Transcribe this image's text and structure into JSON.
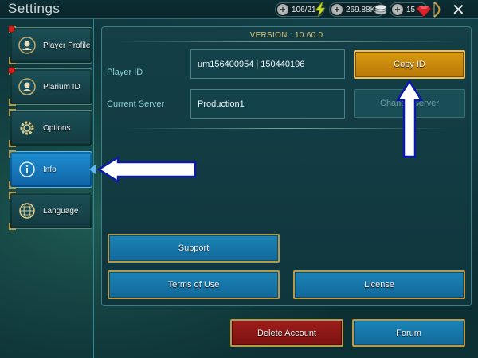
{
  "header": {
    "title": "Settings",
    "resources": [
      {
        "value": "106/21",
        "icon": "energy-bolt-icon"
      },
      {
        "value": "269.88K",
        "icon": "silver-coins-icon"
      },
      {
        "value": "15",
        "icon": "ruby-gem-icon"
      }
    ],
    "close_icon": "✕"
  },
  "sidebar": {
    "items": [
      {
        "label": "Player Profile",
        "icon": "user-circle-icon",
        "notification": true
      },
      {
        "label": "Plarium ID",
        "icon": "user-circle-icon",
        "notification": true
      },
      {
        "label": "Options",
        "icon": "gear-icon",
        "notification": false
      },
      {
        "label": "Info",
        "icon": "info-icon",
        "notification": false,
        "active": true
      },
      {
        "label": "Language",
        "icon": "globe-icon",
        "notification": false
      }
    ]
  },
  "info": {
    "version": "VERSION : 10.60.0",
    "player_id_label": "Player ID",
    "player_id_value": "um156400954 | 150440196",
    "copy_id_label": "Copy ID",
    "current_server_label": "Current Server",
    "current_server_value": "Production1",
    "change_server_label": "Change Server",
    "support_label": "Support",
    "terms_label": "Terms of Use",
    "license_label": "License"
  },
  "footer": {
    "delete_account_label": "Delete Account",
    "forum_label": "Forum"
  },
  "colors": {
    "accent_gold": "#d99a11",
    "button_blue": "#1a83b6",
    "button_red": "#9d1e1b",
    "active_tab": "#1d8fd2",
    "annotation_arrow": "#0a1aa8"
  }
}
